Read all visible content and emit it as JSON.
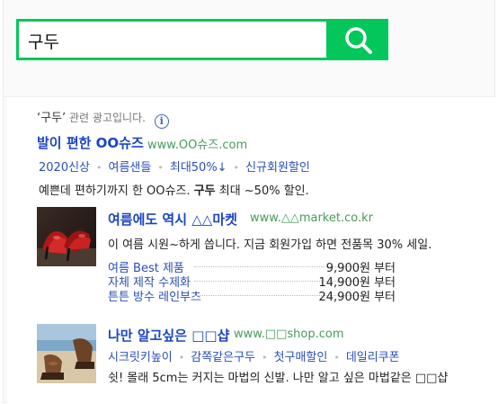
{
  "search": {
    "query": "구두",
    "button_icon": "search-icon"
  },
  "ad_notice": {
    "keyword": "‘구두’",
    "text": "관련 광고입니다.",
    "icon": "info-icon",
    "icon_glyph": "i"
  },
  "ads": [
    {
      "title": "발이 편한 OO슈즈",
      "url": "www.OO슈즈.com",
      "sitelinks": [
        "2020신상",
        "여름샌들",
        "최대50%↓",
        "신규회원할인"
      ],
      "desc_before": "예쁜데 편하기까지 한 OO슈즈. ",
      "desc_bold": "구두",
      "desc_after": " 최대 ~50% 할인."
    },
    {
      "title": "여름에도 역시 △△마켓",
      "url": "www.△△market.co.kr",
      "desc": "이 여름 시원~하게 씁니다. 지금 회원가입 하면 전품목 30% 세일.",
      "thumb": "red-high-heels-image",
      "prices": [
        {
          "name": "여름 Best 제품",
          "value": "9,900원 부터"
        },
        {
          "name": "자체 제작 수제화",
          "value": "14,900원 부터"
        },
        {
          "name": "튼튼 방수 레인부츠",
          "value": "24,900원 부터"
        }
      ]
    },
    {
      "title": "나만 알고싶은 □□샵",
      "url": "www.□□shop.com",
      "sitelinks": [
        "시크릿키높이",
        "감쪽같은구두",
        "첫구매할인",
        "데일리쿠폰"
      ],
      "desc": "쉿! 몰래 5cm는 커지는 마법의 신발. 나만 알고 싶은 마법같은 □□샵",
      "thumb": "brown-shoes-beach-image"
    }
  ],
  "colors": {
    "brand_green": "#03c75a",
    "link_blue": "#1a45c5",
    "url_green": "#4a9a5a"
  }
}
